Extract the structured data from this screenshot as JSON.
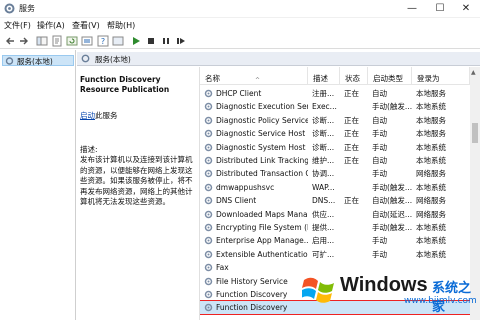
{
  "window": {
    "title": "服务",
    "minimize": "—",
    "maximize": "☐",
    "close": "✕"
  },
  "menu": [
    {
      "label": "文件(F)"
    },
    {
      "label": "操作(A)"
    },
    {
      "label": "查看(V)"
    },
    {
      "label": "帮助(H)"
    }
  ],
  "tree": {
    "label": "服务(本地)"
  },
  "pane_header": {
    "label": "服务(本地)"
  },
  "details": {
    "title": "Function Discovery Resource Publication",
    "link_text": "启动",
    "link_suffix": "此服务",
    "desc_heading": "描述:",
    "desc_body": "发布该计算机以及连接到该计算机的资源，以便能够在网络上发现这些资源。如果该服务被停止，将不再发布网络资源，网络上的其他计算机将无法发现这些资源。"
  },
  "columns": {
    "name": "名称",
    "desc": "描述",
    "status": "状态",
    "startup": "启动类型",
    "logon": "登录为",
    "sort_caret": "^"
  },
  "services": [
    {
      "name": "DHCP Client",
      "desc": "注册...",
      "status": "正在",
      "startup": "自动",
      "logon": "本地服务"
    },
    {
      "name": "Diagnostic Execution Serv...",
      "desc": "Exec...",
      "status": "",
      "startup": "手动(触发...",
      "logon": "本地系统"
    },
    {
      "name": "Diagnostic Policy Service",
      "desc": "诊断...",
      "status": "正在",
      "startup": "自动",
      "logon": "本地服务"
    },
    {
      "name": "Diagnostic Service Host",
      "desc": "诊断...",
      "status": "正在",
      "startup": "手动",
      "logon": "本地服务"
    },
    {
      "name": "Diagnostic System Host",
      "desc": "诊断...",
      "status": "正在",
      "startup": "手动",
      "logon": "本地系统"
    },
    {
      "name": "Distributed Link Tracking...",
      "desc": "维护...",
      "status": "正在",
      "startup": "自动",
      "logon": "本地系统"
    },
    {
      "name": "Distributed Transaction C...",
      "desc": "协调...",
      "status": "",
      "startup": "手动",
      "logon": "网络服务"
    },
    {
      "name": "dmwappushsvc",
      "desc": "WAP...",
      "status": "",
      "startup": "手动(触发...",
      "logon": "本地系统"
    },
    {
      "name": "DNS Client",
      "desc": "DNS...",
      "status": "正在",
      "startup": "自动(触发...",
      "logon": "网络服务"
    },
    {
      "name": "Downloaded Maps Manager",
      "desc": "供应...",
      "status": "",
      "startup": "自动(延迟...",
      "logon": "网络服务"
    },
    {
      "name": "Encrypting File System (E...",
      "desc": "提供...",
      "status": "",
      "startup": "手动(触发...",
      "logon": "本地系统"
    },
    {
      "name": "Enterprise App Manage...",
      "desc": "启用...",
      "status": "",
      "startup": "手动",
      "logon": "本地系统"
    },
    {
      "name": "Extensible Authenticatio...",
      "desc": "可扩...",
      "status": "",
      "startup": "手动",
      "logon": "本地系统"
    },
    {
      "name": "Fax",
      "desc": "",
      "status": "",
      "startup": "",
      "logon": ""
    },
    {
      "name": "File History Service",
      "desc": "",
      "status": "",
      "startup": "",
      "logon": ""
    },
    {
      "name": "Function Discovery",
      "desc": "",
      "status": "",
      "startup": "",
      "logon": ""
    },
    {
      "name": "Function Discovery",
      "desc": "",
      "status": "",
      "startup": "",
      "logon": ""
    }
  ],
  "selected_index": 16,
  "watermark": {
    "brand": "Windows",
    "cn": "系统之家",
    "url": "www.bjjmlv.com"
  },
  "colors": {
    "selection": "#cce4f7",
    "link": "#0645ad",
    "watermark_blue": "#0a6bd6",
    "highlight_outline": "#e22222"
  }
}
